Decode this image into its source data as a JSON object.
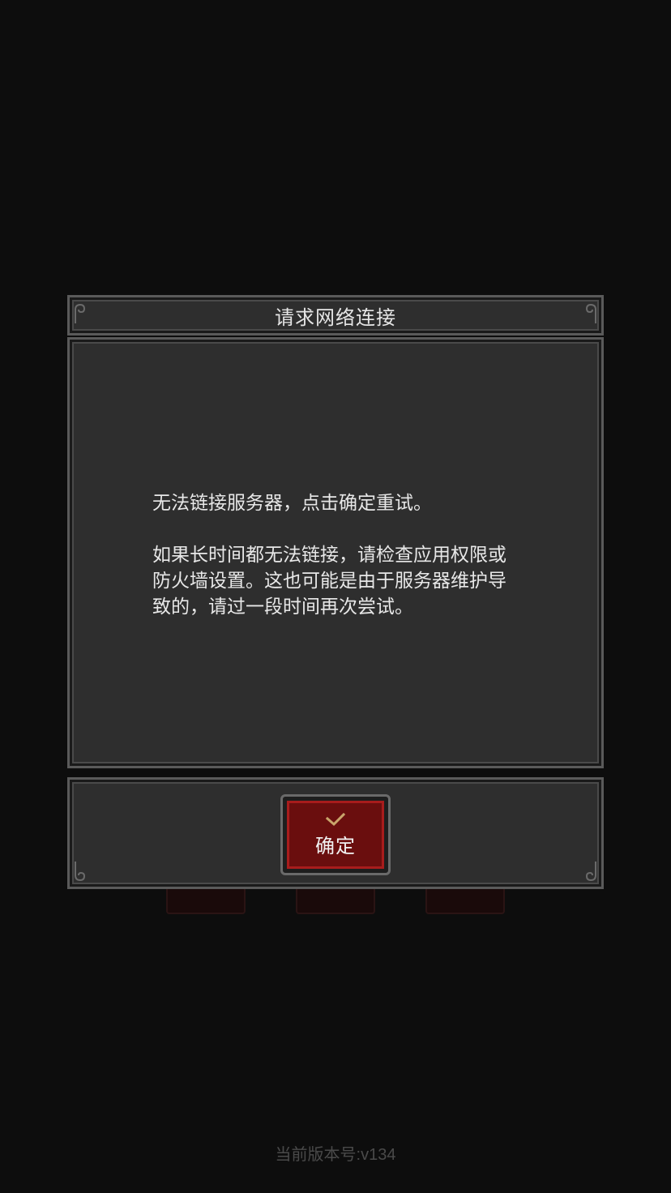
{
  "dialog": {
    "title": "请求网络连接",
    "message_line1": "无法链接服务器，点击确定重试。",
    "message_para2_line1": "如果长时间都无法链接，请检查应用权限或",
    "message_para2_line2": "防火墙设置。这也可能是由于服务器维护导",
    "message_para2_line3": "致的，请过一段时间再次尝试。",
    "confirm_label": "确定"
  },
  "footer": {
    "version_text": "当前版本号:v134"
  },
  "colors": {
    "background": "#0d0d0d",
    "panel": "#2e2e2e",
    "panel_border": "#5a5a5a",
    "button_red": "#6a0e0e",
    "button_border_red": "#a81c1c",
    "check_gold": "#c9a56b"
  },
  "icons": {
    "confirm": "check-icon",
    "corners": "ornament-scroll-icon"
  }
}
